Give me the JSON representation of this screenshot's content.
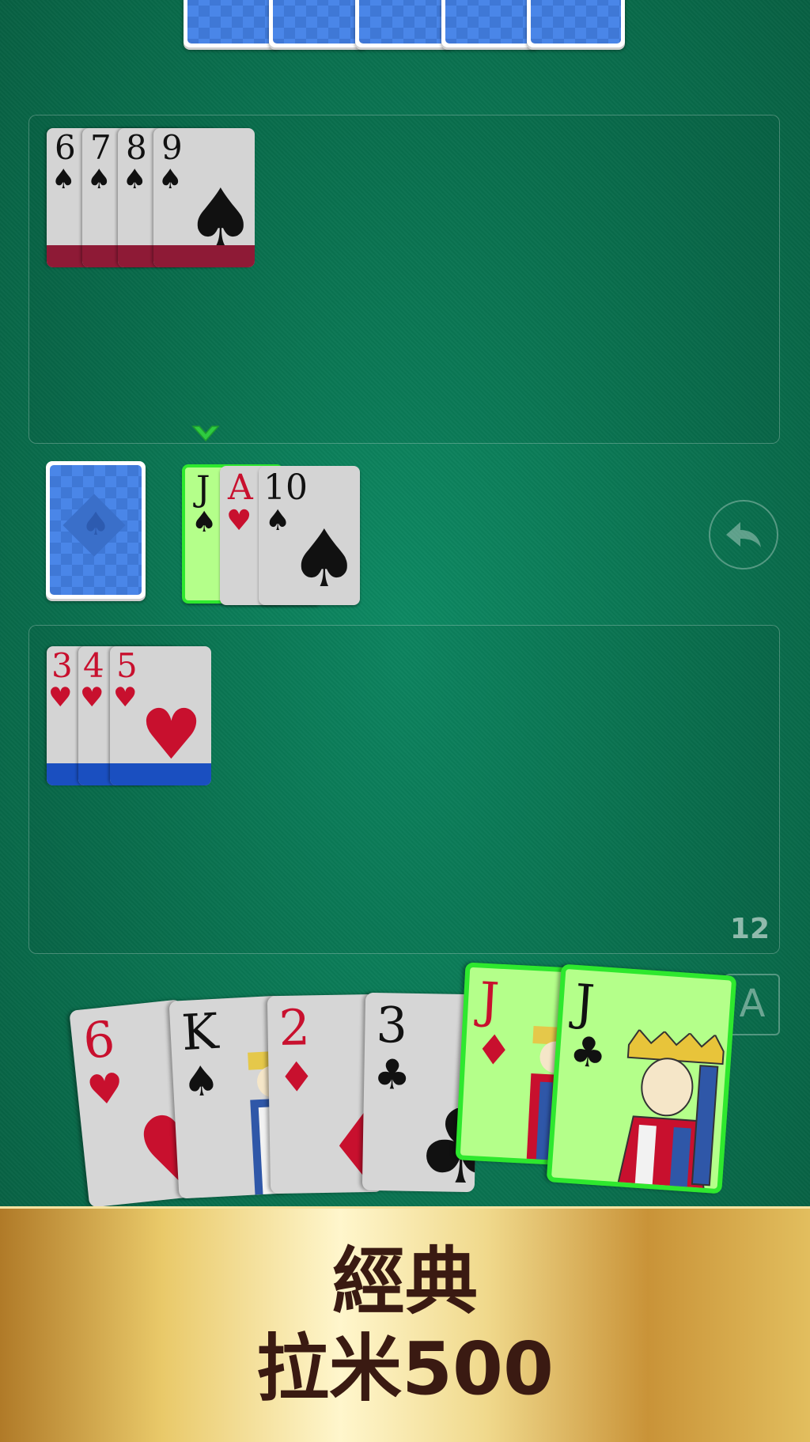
{
  "opponent_hand": {
    "card_count": 5
  },
  "top_meld": {
    "cards": [
      {
        "rank": "6",
        "suit": "♠"
      },
      {
        "rank": "7",
        "suit": "♠"
      },
      {
        "rank": "8",
        "suit": "♠"
      },
      {
        "rank": "9",
        "suit": "♠"
      }
    ]
  },
  "stock": {
    "suit_symbol": "♠"
  },
  "discard_pile": {
    "cards": [
      {
        "rank": "J",
        "suit": "♠",
        "color": "black",
        "selected": true
      },
      {
        "rank": "A",
        "suit": "♥",
        "color": "red"
      },
      {
        "rank": "10",
        "suit": "♠",
        "color": "black"
      }
    ]
  },
  "undo_icon": "undo-arrow-icon",
  "bottom_meld": {
    "cards": [
      {
        "rank": "3",
        "suit": "♥"
      },
      {
        "rank": "4",
        "suit": "♥"
      },
      {
        "rank": "5",
        "suit": "♥"
      }
    ],
    "score": "12"
  },
  "sort_button": {
    "label": "A"
  },
  "player_hand": {
    "cards": [
      {
        "rank": "6",
        "suit": "♥",
        "color": "red"
      },
      {
        "rank": "K",
        "suit": "♠",
        "color": "black"
      },
      {
        "rank": "2",
        "suit": "♦",
        "color": "red"
      },
      {
        "rank": "3",
        "suit": "♣",
        "color": "black"
      },
      {
        "rank": "J",
        "suit": "♦",
        "color": "red",
        "selected": true
      },
      {
        "rank": "J",
        "suit": "♣",
        "color": "black",
        "selected": true
      }
    ]
  },
  "banner": {
    "line1": "經典",
    "line2": "拉米500"
  }
}
